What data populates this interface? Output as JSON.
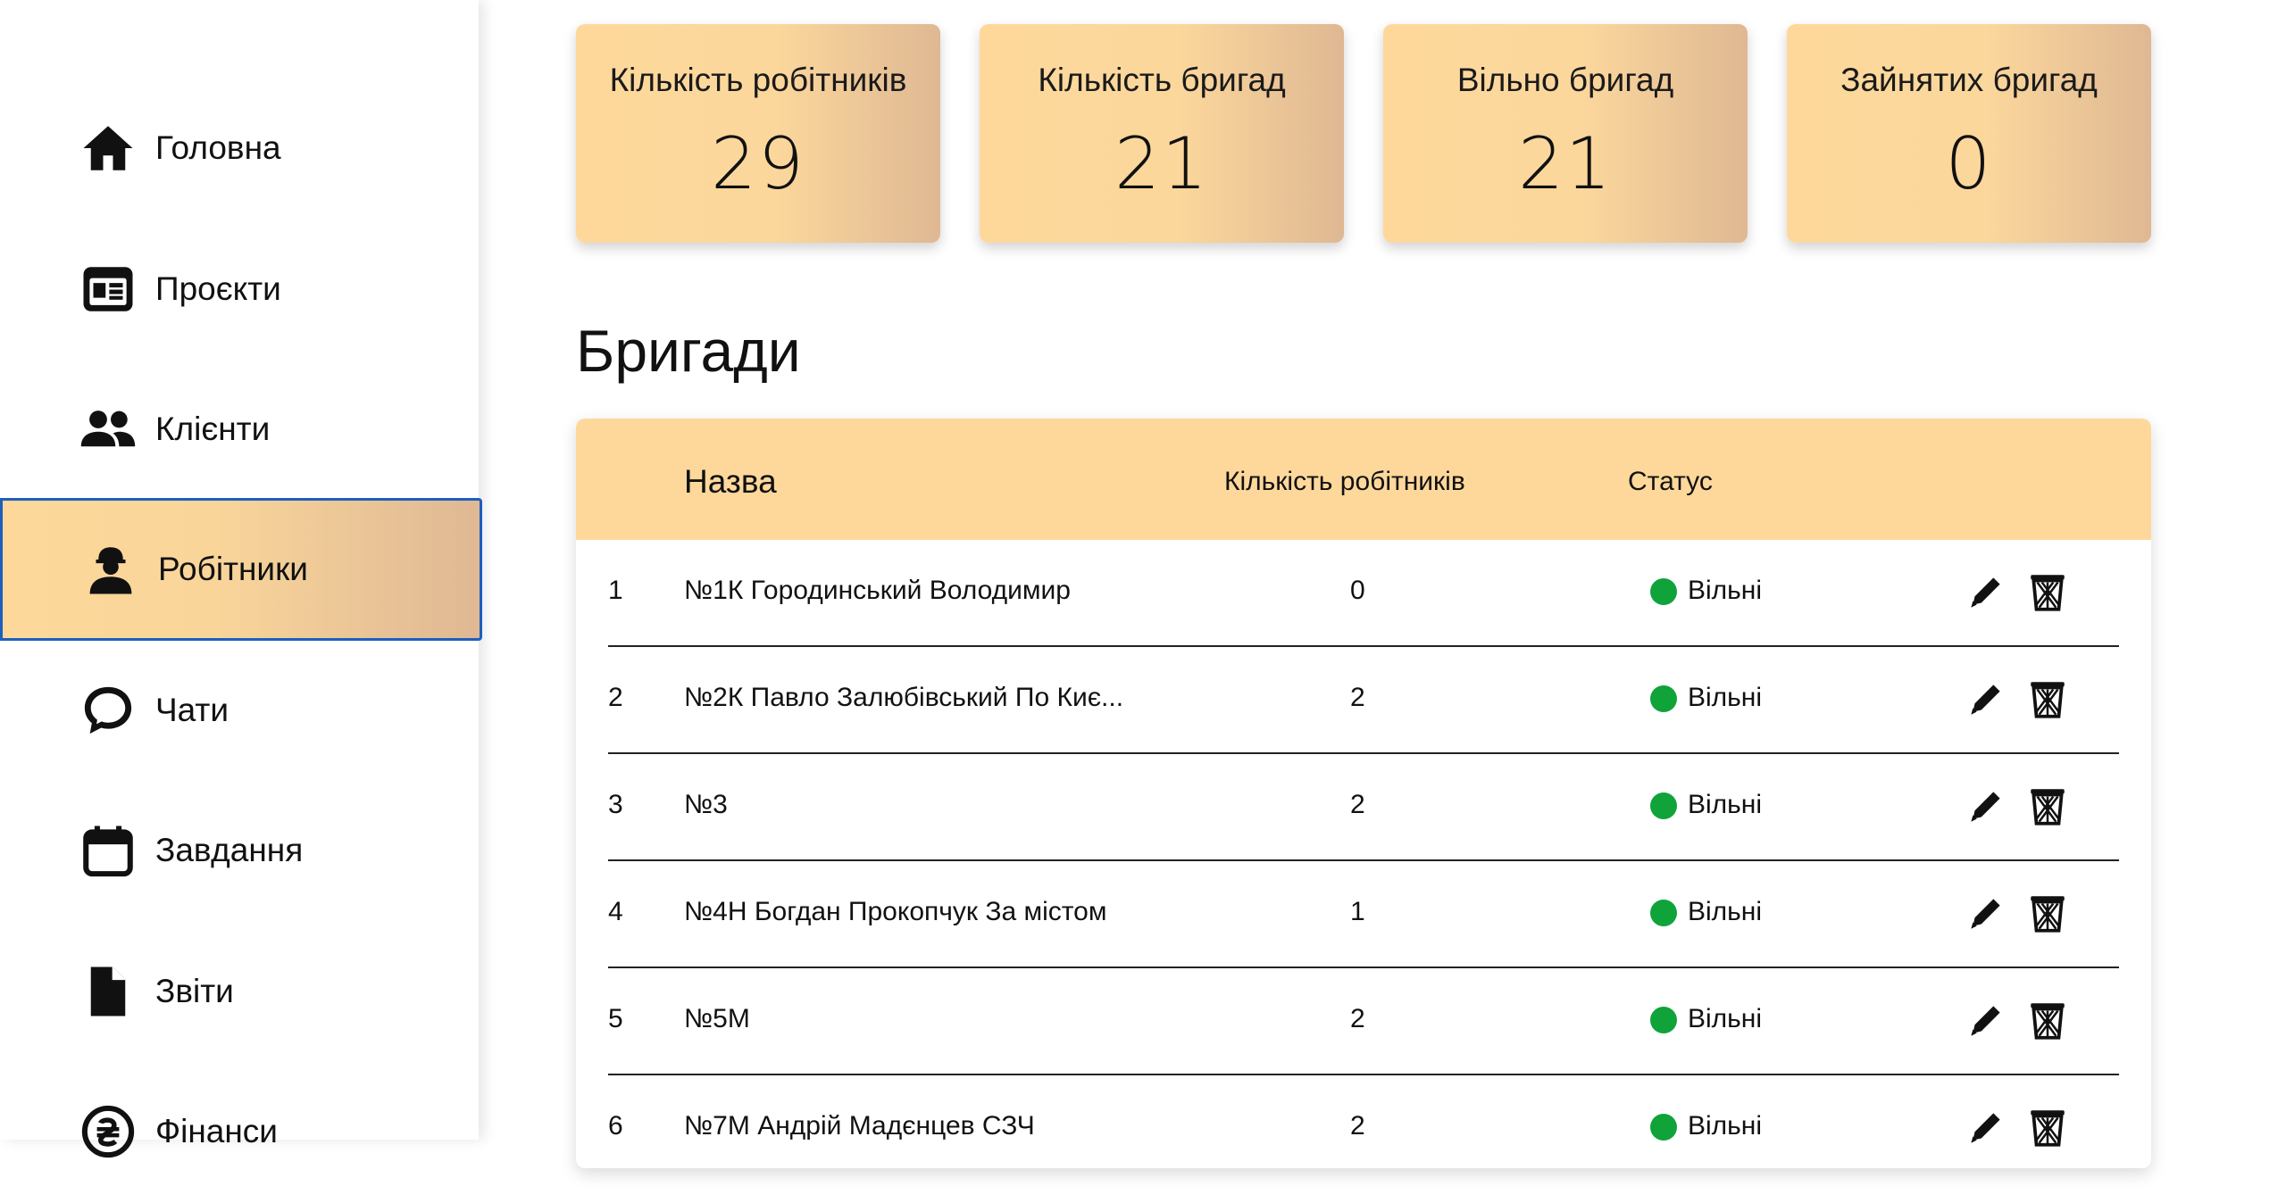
{
  "sidebar": {
    "items": [
      {
        "label": "Головна",
        "icon": "home-icon"
      },
      {
        "label": "Проєкти",
        "icon": "newspaper-icon"
      },
      {
        "label": "Клієнти",
        "icon": "users-icon"
      },
      {
        "label": "Робітники",
        "icon": "worker-icon"
      },
      {
        "label": "Чати",
        "icon": "chat-icon"
      },
      {
        "label": "Завдання",
        "icon": "calendar-icon"
      },
      {
        "label": "Звіти",
        "icon": "file-icon"
      },
      {
        "label": "Фінанси",
        "icon": "hryvnia-icon"
      }
    ],
    "active_index": 3
  },
  "stats": [
    {
      "label": "Кількість робітників",
      "value": "29"
    },
    {
      "label": "Кількість бригад",
      "value": "21"
    },
    {
      "label": "Вільно бригад",
      "value": "21"
    },
    {
      "label": "Зайнятих бригад",
      "value": "0"
    }
  ],
  "section_title": "Бригади",
  "table": {
    "headers": {
      "name": "Назва",
      "workers": "Кількість робітників",
      "status": "Статус"
    },
    "rows": [
      {
        "num": "1",
        "name": "№1К Городинський Володимир",
        "workers": "0",
        "status": "Вільні"
      },
      {
        "num": "2",
        "name": "№2К Павло Залюбівський По Киє...",
        "workers": "2",
        "status": "Вільні"
      },
      {
        "num": "3",
        "name": "№3",
        "workers": "2",
        "status": "Вільні"
      },
      {
        "num": "4",
        "name": "№4Н Богдан Прокопчук За містом",
        "workers": "1",
        "status": "Вільні"
      },
      {
        "num": "5",
        "name": "№5М",
        "workers": "2",
        "status": "Вільні"
      },
      {
        "num": "6",
        "name": "№7М Андрій Мадєнцев СЗЧ",
        "workers": "2",
        "status": "Вільні"
      }
    ]
  },
  "colors": {
    "accent_light": "#fed89b",
    "accent_dark": "#dfb893",
    "active_border": "#1d5fbf",
    "status_free": "#0fa33a"
  }
}
